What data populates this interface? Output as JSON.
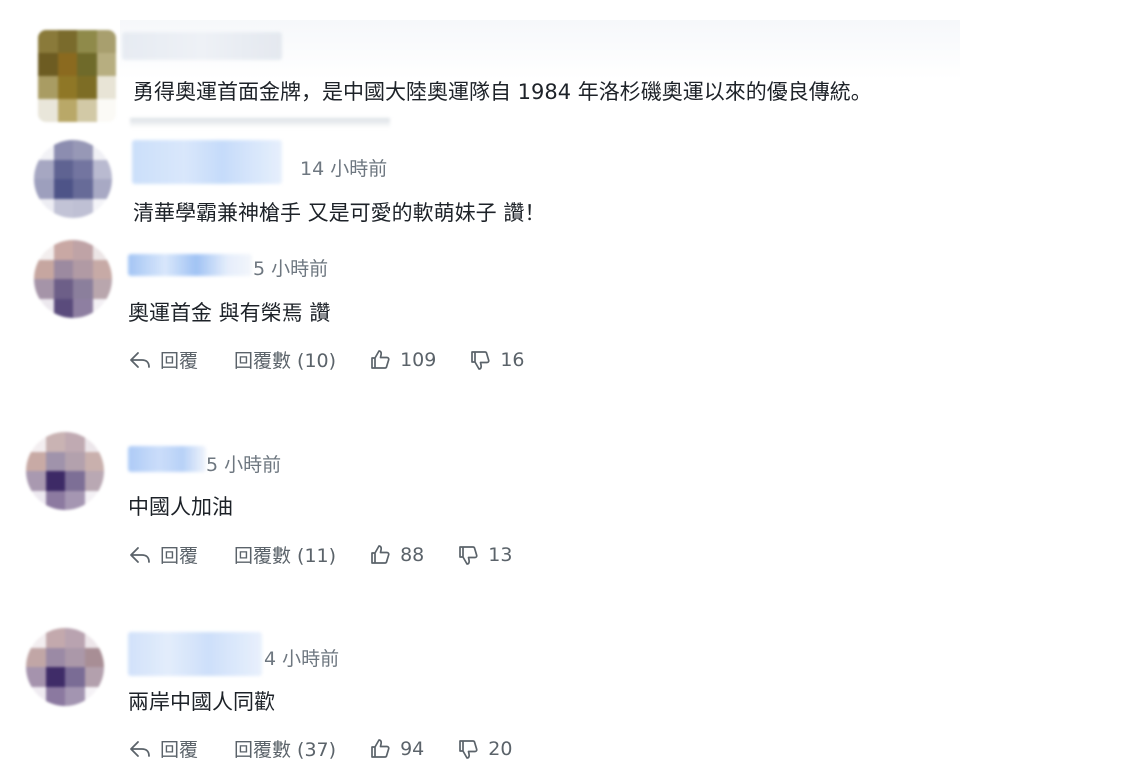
{
  "comments": [
    {
      "text": "勇得奧運首面金牌，是中國大陸奧運隊自 1984 年洛杉磯奧運以來的優良傳統。",
      "time": ""
    },
    {
      "time": "14 小時前",
      "text": "清華學霸兼神槍手 又是可愛的軟萌妹子 讚！"
    },
    {
      "time": "5 小時前",
      "text": "奧運首金 與有榮焉 讚",
      "reply_label": "回覆",
      "replies_label": "回覆數 (10)",
      "likes": "109",
      "dislikes": "16"
    },
    {
      "time": "5 小時前",
      "text": "中國人加油",
      "reply_label": "回覆",
      "replies_label": "回覆數 (11)",
      "likes": "88",
      "dislikes": "13"
    },
    {
      "time": "4 小時前",
      "text": "兩岸中國人同歡",
      "reply_label": "回覆",
      "replies_label": "回覆數 (37)",
      "likes": "94",
      "dislikes": "20"
    }
  ],
  "icons": {
    "reply": "reply-arrow-icon",
    "like": "thumbs-up-icon",
    "dislike": "thumbs-down-icon"
  },
  "colors": {
    "text": "#1d2228",
    "muted": "#6e7780",
    "action": "#5b636a",
    "name_blur": "#c9defa"
  }
}
